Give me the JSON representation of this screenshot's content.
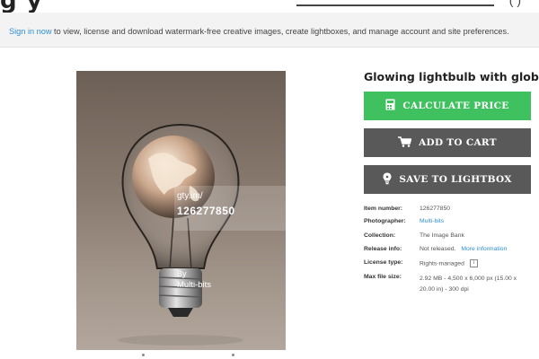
{
  "signin": {
    "link": "Sign in now",
    "text": " to view, license and download watermark-free creative images, create lightboxes, and manage account and site preferences."
  },
  "image": {
    "watermark_url": "gty.im/",
    "watermark_id": "126277850",
    "watermark_by": "By",
    "watermark_author": "Multi-bits"
  },
  "title": "Glowing lightbulb with globe",
  "buttons": {
    "calculate": "CALCULATE PRICE",
    "cart": "ADD TO CART",
    "lightbox": "SAVE TO LIGHTBOX"
  },
  "details": {
    "image_number_label": "Item number:",
    "image_number": "126277850",
    "photographer_label": "Photographer:",
    "photographer": "Multi-bits",
    "collection_label": "Collection:",
    "collection": "The Image Bank",
    "release_label": "Release info:",
    "release": "Not released.",
    "release_link": "More information",
    "license_label": "License type:",
    "license": "Rights-managed",
    "info_glyph": "i",
    "size_label": "Max file size:",
    "size": "2.92 MB - 4,500 x 6,000 px (15.00 x 20.00 in) - 300 dpi"
  },
  "colors": {
    "accent_green": "#3ec15e",
    "button_gray": "#595959",
    "link_blue": "#2f8fd6"
  }
}
